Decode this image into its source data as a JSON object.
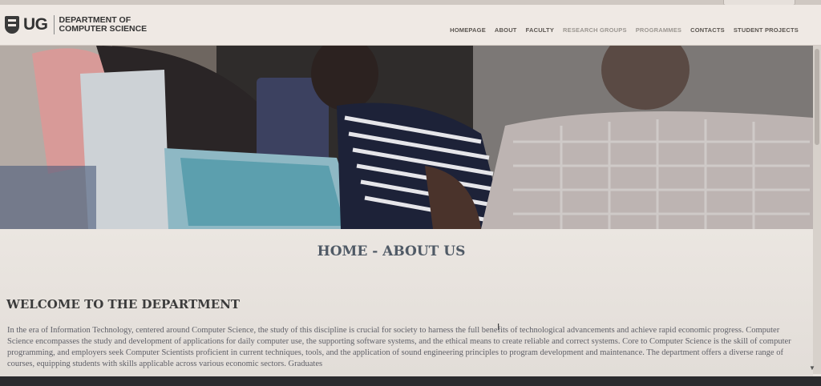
{
  "header": {
    "logo_short": "UG",
    "logo_dept": "DEPARTMENT OF COMPUTER SCIENCE",
    "nav": [
      {
        "label": "HOMEPAGE"
      },
      {
        "label": "ABOUT"
      },
      {
        "label": "FACULTY"
      },
      {
        "label": "RESEARCH GROUPS"
      },
      {
        "label": "PROGRAMMES"
      },
      {
        "label": "CONTACTS"
      },
      {
        "label": "STUDENT PROJECTS"
      }
    ]
  },
  "main": {
    "page_heading": "HOME - ABOUT US",
    "welcome_heading": "WELCOME TO THE DEPARTMENT",
    "body_text": "In the era of Information Technology, centered around Computer Science, the study of this discipline is crucial for society to harness the full benefits of technological advancements and achieve rapid economic progress. Computer Science encompasses the study and development of applications for daily computer use, the supporting software systems, and the ethical means to create reliable and correct systems. Core to Computer Science is the skill of computer programming, and employers seek Computer Scientists proficient in current techniques, tools, and the application of sound engineering principles to program development and maintenance. The department offers a diverse range of courses, equipping students with skills applicable across various economic sectors. Graduates"
  },
  "colors": {
    "header_bg": "#efe9e4",
    "heading_color": "#505a66",
    "text_color": "#5f6068"
  },
  "icons": {
    "logo": "shield-icon",
    "cursor": "text-cursor-icon"
  }
}
